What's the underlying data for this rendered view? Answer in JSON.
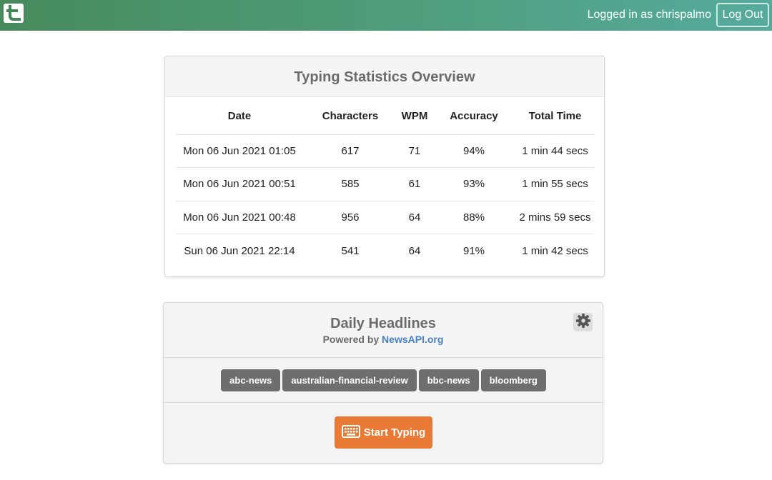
{
  "navbar": {
    "logo_icon": "t-logo-icon",
    "user_text": "Logged in as chrispalmo",
    "logout_label": "Log Out"
  },
  "stats": {
    "title": "Typing Statistics Overview",
    "columns": [
      "Date",
      "Characters",
      "WPM",
      "Accuracy",
      "Total Time"
    ],
    "rows": [
      [
        "Mon 06 Jun 2021 01:05",
        "617",
        "71",
        "94%",
        "1 min 44 secs"
      ],
      [
        "Mon 06 Jun 2021 00:51",
        "585",
        "61",
        "93%",
        "1 min 55 secs"
      ],
      [
        "Mon 06 Jun 2021 00:48",
        "956",
        "64",
        "88%",
        "2 mins 59 secs"
      ],
      [
        "Sun 06 Jun 2021 22:14",
        "541",
        "64",
        "91%",
        "1 min 42 secs"
      ]
    ]
  },
  "headlines": {
    "title": "Daily Headlines",
    "powered_prefix": "Powered by ",
    "powered_link": "NewsAPI.org",
    "settings_icon": "gear-icon",
    "sources": [
      "abc-news",
      "australian-financial-review",
      "bbc-news",
      "bloomberg"
    ],
    "start_label": "Start Typing",
    "start_icon": "keyboard-icon"
  },
  "colors": {
    "navbar_gradient_start": "#478a5d",
    "navbar_gradient_end": "#56ab9c",
    "accent_orange": "#e87a36",
    "badge_gray": "#6e6e6e",
    "link_blue": "#4a7fc1"
  }
}
